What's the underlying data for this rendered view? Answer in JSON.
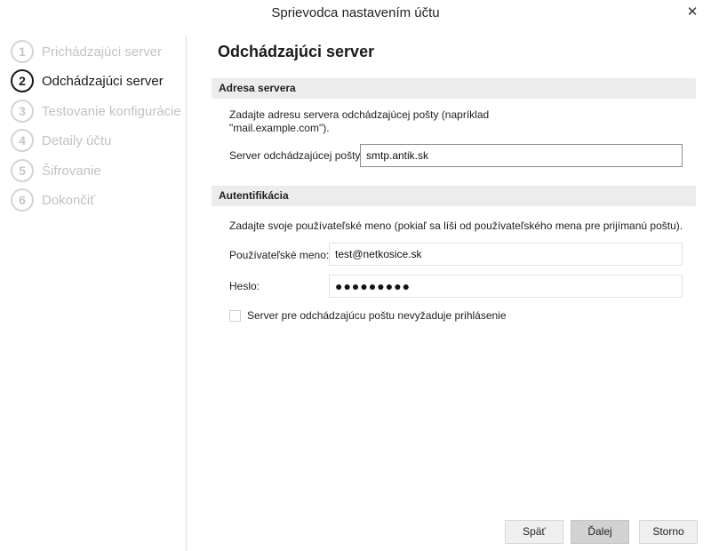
{
  "window": {
    "title": "Sprievodca nastavením účtu",
    "close_glyph": "✕"
  },
  "steps": [
    {
      "num": "1",
      "label": "Prichádzajúci server",
      "state": "done"
    },
    {
      "num": "2",
      "label": "Odchádzajúci server",
      "state": "active"
    },
    {
      "num": "3",
      "label": "Testovanie konfigurácie",
      "state": "pending"
    },
    {
      "num": "4",
      "label": "Detaily účtu",
      "state": "pending"
    },
    {
      "num": "5",
      "label": "Šifrovanie",
      "state": "pending"
    },
    {
      "num": "6",
      "label": "Dokončiť",
      "state": "pending"
    }
  ],
  "page": {
    "title": "Odchádzajúci server"
  },
  "server_section": {
    "heading": "Adresa servera",
    "description_line1": "Zadajte adresu servera odchádzajúcej pošty (napríklad",
    "description_line2": "\"mail.example.com\").",
    "field_label": "Server odchádzajúcej pošty:",
    "field_value": "smtp.antik.sk"
  },
  "auth_section": {
    "heading": "Autentifikácia",
    "description": "Zadajte svoje používateľské meno (pokiaľ sa líši od používateľského mena pre prijímanú poštu).",
    "username_label": "Používateľské meno:",
    "username_value": "test@netkosice.sk",
    "password_label": "Heslo:",
    "password_mask": "●●●●●●●●●",
    "checkbox_label": "Server pre odchádzajúcu poštu nevyžaduje prihlásenie",
    "checkbox_checked": false
  },
  "buttons": {
    "back": "Späť",
    "next": "Ďalej",
    "cancel": "Storno"
  },
  "colors": {
    "active_step": "#1a1a1a",
    "inactive_step": "#c2c2c2",
    "section_bg": "#ececec",
    "primary_button": "#d2d2d2"
  }
}
